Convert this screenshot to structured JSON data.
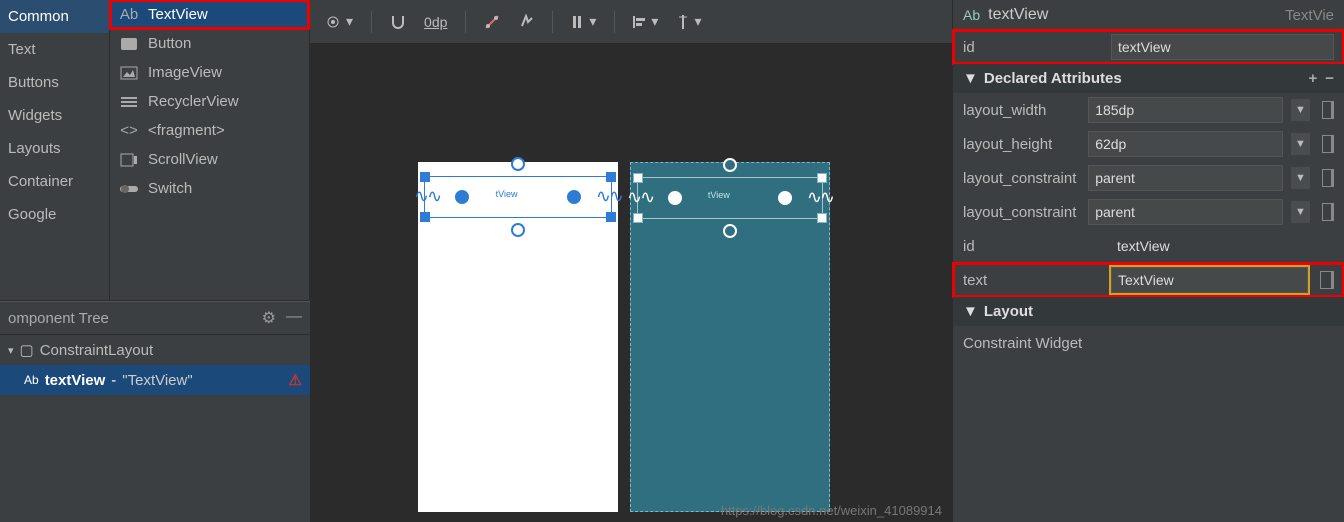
{
  "palette": {
    "categories": [
      "Common",
      "Text",
      "Buttons",
      "Widgets",
      "Layouts",
      "Container",
      "Google"
    ],
    "items": [
      {
        "label": "TextView",
        "icon": "textview-icon"
      },
      {
        "label": "Button",
        "icon": "button-icon"
      },
      {
        "label": "ImageView",
        "icon": "imageview-icon"
      },
      {
        "label": "RecyclerView",
        "icon": "recyclerview-icon"
      },
      {
        "label": "<fragment>",
        "icon": "fragment-icon"
      },
      {
        "label": "ScrollView",
        "icon": "scrollview-icon"
      },
      {
        "label": "Switch",
        "icon": "switch-icon"
      }
    ]
  },
  "component_tree": {
    "title": "omponent Tree",
    "root": {
      "label": "ConstraintLayout",
      "icon": "constraint-icon"
    },
    "child": {
      "id": "textView",
      "text": "\"TextView\"",
      "icon": "textview-icon"
    }
  },
  "toolbar": {
    "margin": "0dp"
  },
  "canvas": {
    "tv_label": "tView"
  },
  "attributes": {
    "header_label": "textView",
    "header_class": "TextVie",
    "id_label": "id",
    "id_value": "textView",
    "section_decl": "Declared Attributes",
    "rows": [
      {
        "name": "layout_width",
        "value": "185dp",
        "dropdown": true
      },
      {
        "name": "layout_height",
        "value": "62dp",
        "dropdown": true
      },
      {
        "name": "layout_constraint",
        "value": "parent",
        "dropdown": true
      },
      {
        "name": "layout_constraint",
        "value": "parent",
        "dropdown": true
      },
      {
        "name": "id",
        "value": "textView",
        "dropdown": false
      },
      {
        "name": "text",
        "value": "TextView",
        "dropdown": false
      }
    ],
    "section_layout": "Layout",
    "constraint_widget": "Constraint Widget"
  },
  "watermark": "https://blog.csdn.net/weixin_41089914"
}
